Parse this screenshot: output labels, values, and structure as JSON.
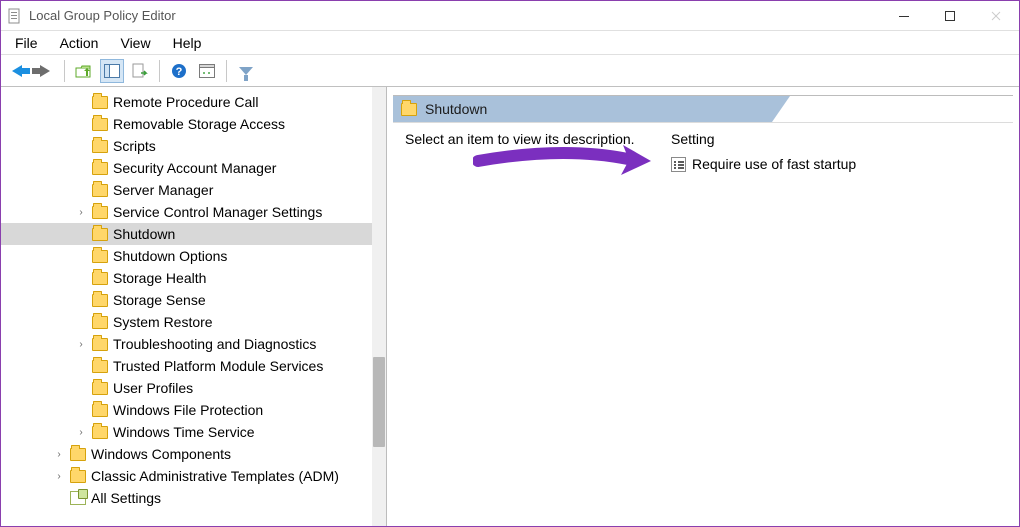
{
  "window": {
    "title": "Local Group Policy Editor"
  },
  "menu": {
    "file": "File",
    "action": "Action",
    "view": "View",
    "help": "Help"
  },
  "tree": {
    "items": [
      {
        "label": "Remote Procedure Call",
        "indent": 3,
        "caret": ""
      },
      {
        "label": "Removable Storage Access",
        "indent": 3,
        "caret": ""
      },
      {
        "label": "Scripts",
        "indent": 3,
        "caret": ""
      },
      {
        "label": "Security Account Manager",
        "indent": 3,
        "caret": ""
      },
      {
        "label": "Server Manager",
        "indent": 3,
        "caret": ""
      },
      {
        "label": "Service Control Manager Settings",
        "indent": 3,
        "caret": ">"
      },
      {
        "label": "Shutdown",
        "indent": 3,
        "caret": "",
        "selected": true
      },
      {
        "label": "Shutdown Options",
        "indent": 3,
        "caret": ""
      },
      {
        "label": "Storage Health",
        "indent": 3,
        "caret": ""
      },
      {
        "label": "Storage Sense",
        "indent": 3,
        "caret": ""
      },
      {
        "label": "System Restore",
        "indent": 3,
        "caret": ""
      },
      {
        "label": "Troubleshooting and Diagnostics",
        "indent": 3,
        "caret": ">"
      },
      {
        "label": "Trusted Platform Module Services",
        "indent": 3,
        "caret": ""
      },
      {
        "label": "User Profiles",
        "indent": 3,
        "caret": ""
      },
      {
        "label": "Windows File Protection",
        "indent": 3,
        "caret": ""
      },
      {
        "label": "Windows Time Service",
        "indent": 3,
        "caret": ">"
      },
      {
        "label": "Windows Components",
        "indent": 2,
        "caret": ">"
      },
      {
        "label": "Classic Administrative Templates (ADM)",
        "indent": 2,
        "caret": ">"
      },
      {
        "label": "All Settings",
        "indent": 2,
        "caret": "",
        "icon": "allsettings"
      }
    ]
  },
  "details": {
    "header": "Shutdown",
    "desc": "Select an item to view its description.",
    "col_header": "Setting",
    "settings": [
      {
        "label": "Require use of fast startup"
      }
    ]
  }
}
